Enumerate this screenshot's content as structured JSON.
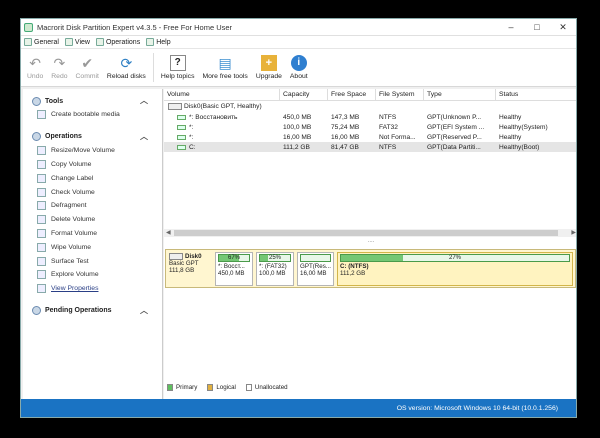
{
  "window": {
    "title": "Macrorit Disk Partition Expert v4.3.5 - Free For Home User",
    "min": "–",
    "max": "□",
    "close": "✕"
  },
  "menu": [
    {
      "label": "General",
      "icon": "general-icon"
    },
    {
      "label": "View",
      "icon": "view-icon"
    },
    {
      "label": "Operations",
      "icon": "operations-icon"
    },
    {
      "label": "Help",
      "icon": "help-icon"
    }
  ],
  "toolbar": [
    {
      "label": "Undo",
      "icon": "undo-icon",
      "glyph": "↶",
      "disabled": true
    },
    {
      "label": "Redo",
      "icon": "redo-icon",
      "glyph": "↷",
      "disabled": true
    },
    {
      "label": "Commit",
      "icon": "commit-icon",
      "glyph": "✔",
      "disabled": true
    },
    {
      "label": "Reload disks",
      "icon": "reload-icon",
      "glyph": "⟳",
      "disabled": false
    },
    {
      "label": "Help topics",
      "icon": "help-topics-icon",
      "glyph": "?",
      "disabled": false
    },
    {
      "label": "More free tools",
      "icon": "free-tools-icon",
      "glyph": "▤",
      "disabled": false
    },
    {
      "label": "Upgrade",
      "icon": "upgrade-icon",
      "glyph": "+",
      "disabled": false
    },
    {
      "label": "About",
      "icon": "about-icon",
      "glyph": "i",
      "disabled": false
    }
  ],
  "sidebar": {
    "tools_title": "Tools",
    "tools_items": [
      "Create bootable media"
    ],
    "operations_title": "Operations",
    "operations_items": [
      "Resize/Move Volume",
      "Copy Volume",
      "Change Label",
      "Check Volume",
      "Defragment",
      "Delete Volume",
      "Format Volume",
      "Wipe Volume",
      "Surface Test",
      "Explore Volume",
      "View Properties"
    ],
    "pending_title": "Pending Operations"
  },
  "table": {
    "columns": [
      "Volume",
      "Capacity",
      "Free Space",
      "File System",
      "Type",
      "Status"
    ],
    "disk_label": "Disk0(Basic GPT, Healthy)",
    "rows": [
      [
        "*: Восстановить",
        "450,0 MB",
        "147,3 MB",
        "NTFS",
        "GPT(Unknown P...",
        "Healthy"
      ],
      [
        "*:",
        "100,0 MB",
        "75,24 MB",
        "FAT32",
        "GPT(EFI System ...",
        "Healthy(System)"
      ],
      [
        "*:",
        "16,00 MB",
        "16,00 MB",
        "Not Forma...",
        "GPT(Reserved P...",
        "Healthy"
      ],
      [
        "C:",
        "111,2 GB",
        "81,47 GB",
        "NTFS",
        "GPT(Data Partiti...",
        "Healthy(Boot)"
      ]
    ],
    "selected_row": 3
  },
  "splitter": "....",
  "diskmap": {
    "disk_name": "Disk0",
    "disk_type": "Basic GPT",
    "disk_size": "111,8 GB",
    "partitions": [
      {
        "pct_label": "67%",
        "pct": 0.67,
        "name": "*: Восст...",
        "size": "450,0 MB"
      },
      {
        "pct_label": "25%",
        "pct": 0.25,
        "name": "*: (FAT32)",
        "size": "100,0 MB"
      },
      {
        "pct_label": "",
        "pct": 0.0,
        "name": "GPT(Res...",
        "size": "16,00 MB"
      },
      {
        "pct_label": "27%",
        "pct": 0.27,
        "name": "C: (NTFS)",
        "size": "111,2 GB"
      }
    ]
  },
  "legend": [
    {
      "label": "Primary",
      "color": "#5fbf5f"
    },
    {
      "label": "Logical",
      "color": "#e0b040"
    },
    {
      "label": "Unallocated",
      "color": "#ffffff"
    }
  ],
  "statusbar": {
    "text": "OS version: Microsoft Windows 10  64-bit  (10.0.1.256)"
  },
  "colors": {
    "accent": "#1a73c3",
    "primary": "#5fbf5f",
    "disk_bg": "#fff6d0"
  }
}
